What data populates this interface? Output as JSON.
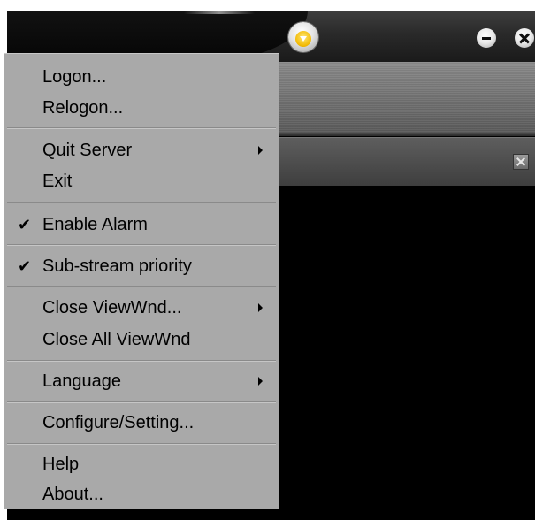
{
  "titlebar": {
    "menu_button_icon": "dropdown-arrow-icon",
    "minimize_icon": "minimize-icon",
    "close_icon": "close-icon"
  },
  "panel": {
    "close_icon": "close-icon"
  },
  "menu": {
    "logon": "Logon...",
    "relogon": "Relogon...",
    "quit_server": "Quit Server",
    "exit": "Exit",
    "enable_alarm": "Enable Alarm",
    "sub_stream_priority": "Sub-stream priority",
    "close_viewwnd": "Close ViewWnd...",
    "close_all_viewwnd": "Close All ViewWnd",
    "language": "Language",
    "configure_setting": "Configure/Setting...",
    "help": "Help",
    "about": "About...",
    "check_mark": "✔"
  },
  "colors": {
    "menu_background": "#a9a9a9",
    "accent_yellow": "#f2b800"
  }
}
